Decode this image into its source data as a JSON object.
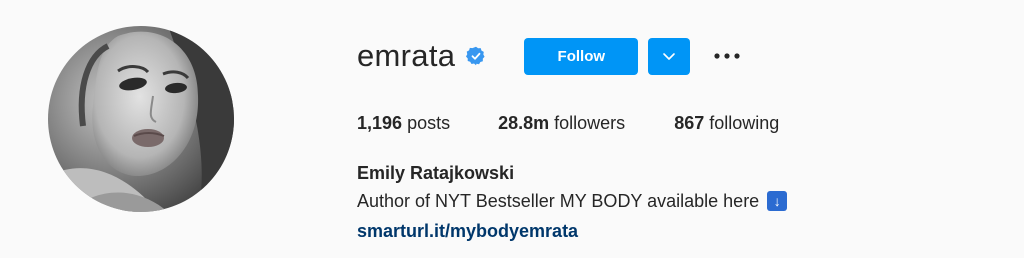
{
  "profile": {
    "username": "emrata",
    "verified": true,
    "follow_label": "Follow",
    "stats": {
      "posts_count": "1,196",
      "posts_label": "posts",
      "followers_count": "28.8m",
      "followers_label": "followers",
      "following_count": "867",
      "following_label": "following"
    },
    "full_name": "Emily Ratajkowski",
    "bio": "Author of NYT Bestseller MY BODY available here",
    "bio_emoji": "↓",
    "link": "smarturl.it/mybodyemrata"
  },
  "icons": {
    "verified": "verified-badge-icon",
    "dropdown": "chevron-down-icon",
    "more": "more-options-icon"
  },
  "colors": {
    "primary_button": "#0095f6",
    "verified_badge": "#3897f0",
    "link": "#00376b",
    "text": "#262626",
    "background": "#fafafa"
  }
}
